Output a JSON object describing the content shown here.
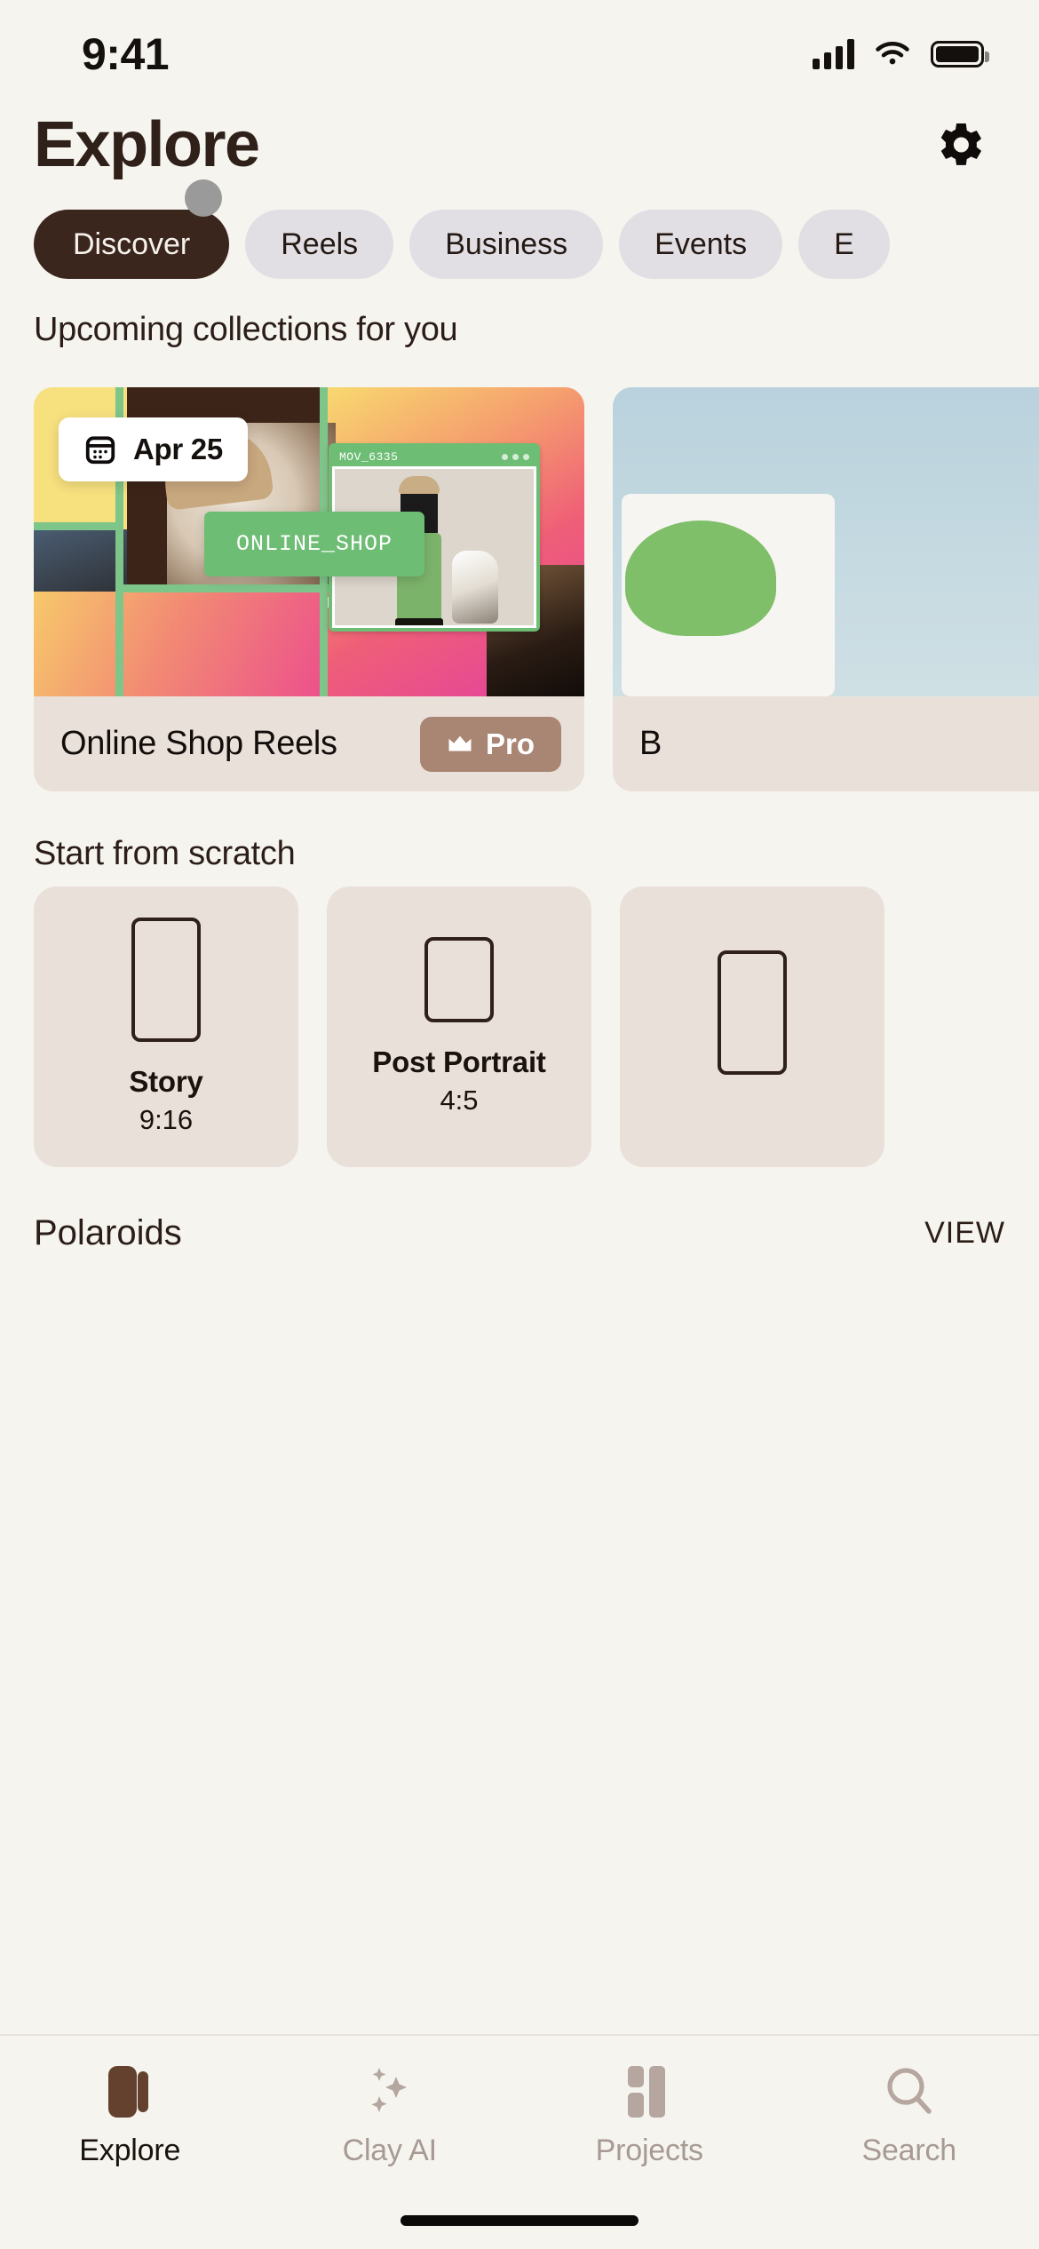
{
  "status_bar": {
    "time": "9:41",
    "signal_icon": "cellular-signal-icon",
    "wifi_icon": "wifi-icon",
    "battery_icon": "battery-icon"
  },
  "header": {
    "title": "Explore",
    "settings_icon": "gear-icon"
  },
  "chips": [
    {
      "label": "Discover",
      "active": true
    },
    {
      "label": "Reels",
      "active": false
    },
    {
      "label": "Business",
      "active": false
    },
    {
      "label": "Events",
      "active": false
    },
    {
      "label": "E",
      "active": false
    }
  ],
  "sections": {
    "collections_title": "Upcoming collections for you",
    "scratch_title": "Start from scratch"
  },
  "collection_cards": [
    {
      "name": "Online Shop Reels",
      "badge": "Pro",
      "badge_icon": "crown-icon",
      "date_label": "Apr 25",
      "date_icon": "calendar-icon",
      "window_label": "MOV_6335",
      "banner_label": "ONLINE_SHOP"
    },
    {
      "name": "B"
    }
  ],
  "scratch_cards": [
    {
      "name": "Story",
      "ratio": "9:16",
      "shape": "portrait-tall"
    },
    {
      "name": "Post Portrait",
      "ratio": "4:5",
      "shape": "portrait-short"
    },
    {
      "name": "",
      "ratio": "",
      "shape": "portrait-tall"
    }
  ],
  "partial_row": {
    "title": "Polaroids",
    "action": "VIEW"
  },
  "tabbar": [
    {
      "label": "Explore",
      "icon": "explore-book-icon",
      "active": true
    },
    {
      "label": "Clay AI",
      "icon": "sparkles-icon",
      "active": false
    },
    {
      "label": "Projects",
      "icon": "projects-grid-icon",
      "active": false
    },
    {
      "label": "Search",
      "icon": "search-icon",
      "active": false
    }
  ],
  "colors": {
    "background": "#f6f4ef",
    "accent_dark": "#3a261d",
    "chip_inactive": "#e2dfe4",
    "card_surface": "#e9e0da",
    "pro_badge": "#a98573",
    "green_accent": "#6dbd74",
    "tab_inactive": "#a79a93"
  }
}
